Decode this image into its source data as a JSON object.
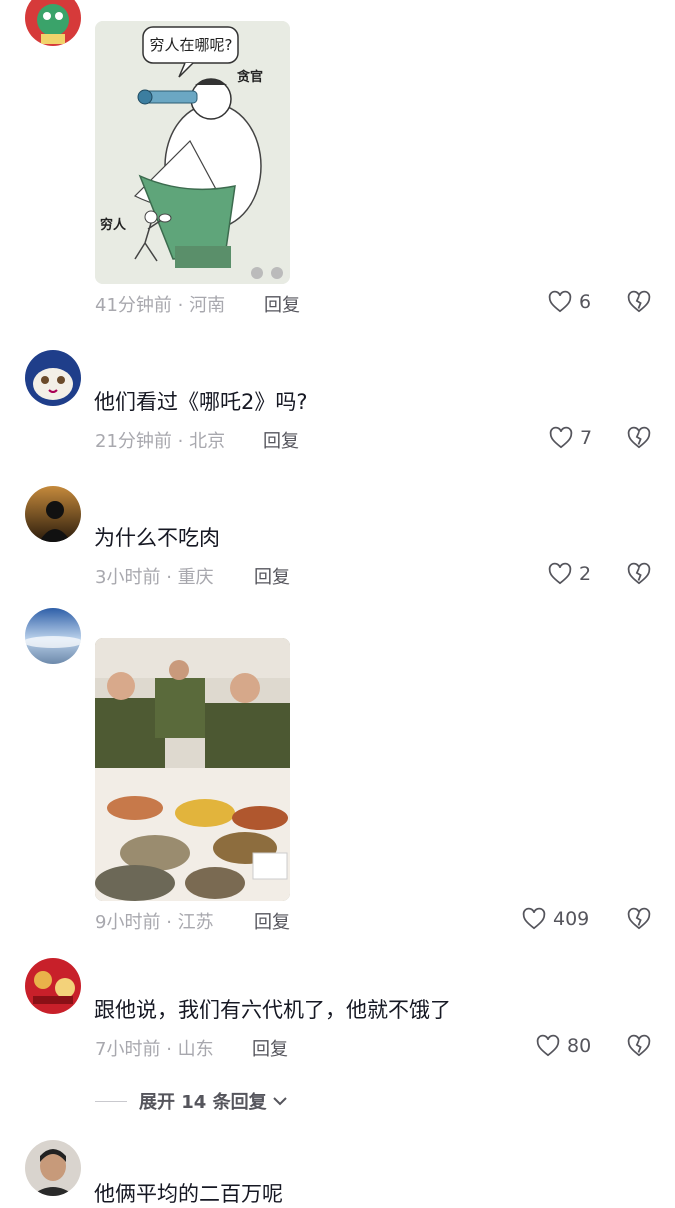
{
  "comments": [
    {
      "avatar": "avatar-red-cartoon",
      "username": "",
      "text": "",
      "image": {
        "kind": "cartoon",
        "speech_bubble": "穷人在哪呢?",
        "label_official": "贪官",
        "label_poor": "穷人"
      },
      "time": "41分钟前",
      "location": "河南",
      "reply_label": "回复",
      "likes": "6"
    },
    {
      "avatar": "avatar-cat",
      "username": "",
      "text": "他们看过《哪吒2》吗?",
      "time": "21分钟前",
      "location": "北京",
      "reply_label": "回复",
      "likes": "7"
    },
    {
      "avatar": "avatar-silhouette",
      "username": "",
      "text": "为什么不吃肉",
      "time": "3小时前",
      "location": "重庆",
      "reply_label": "回复",
      "likes": "2"
    },
    {
      "avatar": "avatar-sky",
      "username": "",
      "text": "",
      "image": {
        "kind": "banquet-photo"
      },
      "time": "9小时前",
      "location": "江苏",
      "reply_label": "回复",
      "likes": "409"
    },
    {
      "avatar": "avatar-red-pattern",
      "username": "",
      "text": "跟他说，我们有六代机了，他就不饿了",
      "time": "7小时前",
      "location": "山东",
      "reply_label": "回复",
      "likes": "80"
    },
    {
      "avatar": "avatar-man",
      "text": "他俩平均的二百万呢"
    }
  ],
  "expand_replies": "展开 14 条回复",
  "colors": {
    "text_primary": "#161823",
    "text_meta": "#a8a8ae",
    "text_action": "#55555c",
    "background": "#ffffff"
  }
}
